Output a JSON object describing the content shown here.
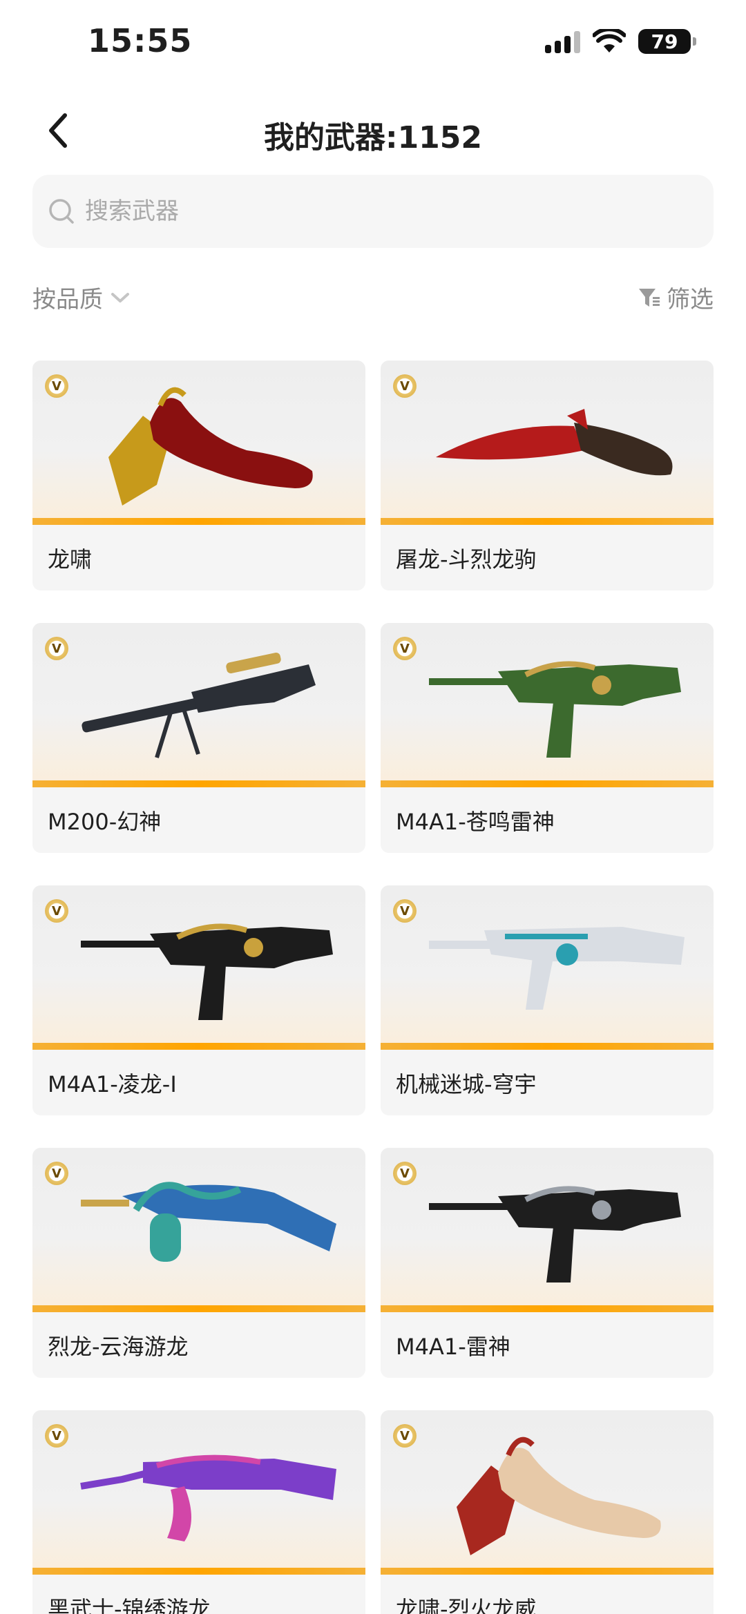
{
  "status": {
    "time": "15:55",
    "battery": "79"
  },
  "header": {
    "title": "我的武器:1152"
  },
  "search": {
    "placeholder": "搜索武器"
  },
  "filters": {
    "sort_label": "按品质",
    "filter_label": "筛选"
  },
  "badge_text": "V",
  "colors": {
    "accent_bar": "#ffa500",
    "card_bg": "#f5f5f5",
    "muted_text": "#8a8a8a"
  },
  "weapons": [
    {
      "name": "龙啸",
      "kind": "axe",
      "palette": [
        "#c79a1b",
        "#8a1010"
      ]
    },
    {
      "name": "屠龙-斗烈龙驹",
      "kind": "knife",
      "palette": [
        "#b51b1b",
        "#3a2a20"
      ]
    },
    {
      "name": "M200-幻神",
      "kind": "sniper",
      "palette": [
        "#2b2f36",
        "#c9a44a"
      ]
    },
    {
      "name": "M4A1-苍鸣雷神",
      "kind": "rifle",
      "palette": [
        "#3c6a2e",
        "#c8a24a"
      ]
    },
    {
      "name": "M4A1-凌龙-I",
      "kind": "rifle",
      "palette": [
        "#1c1c1c",
        "#c9a13c"
      ]
    },
    {
      "name": "机械迷城-穹宇",
      "kind": "smg",
      "palette": [
        "#d9dde3",
        "#2a9fb0"
      ]
    },
    {
      "name": "烈龙-云海游龙",
      "kind": "tommy",
      "palette": [
        "#2f6fb5",
        "#36a39a"
      ]
    },
    {
      "name": "M4A1-雷神",
      "kind": "rifle",
      "palette": [
        "#1e1e1e",
        "#9aa0a8"
      ]
    },
    {
      "name": "黑武士-锦绣游龙",
      "kind": "ak",
      "palette": [
        "#7c3ec9",
        "#d246a8"
      ]
    },
    {
      "name": "龙啸-烈火龙威",
      "kind": "axe",
      "palette": [
        "#a8281f",
        "#e7c9a8"
      ]
    }
  ]
}
